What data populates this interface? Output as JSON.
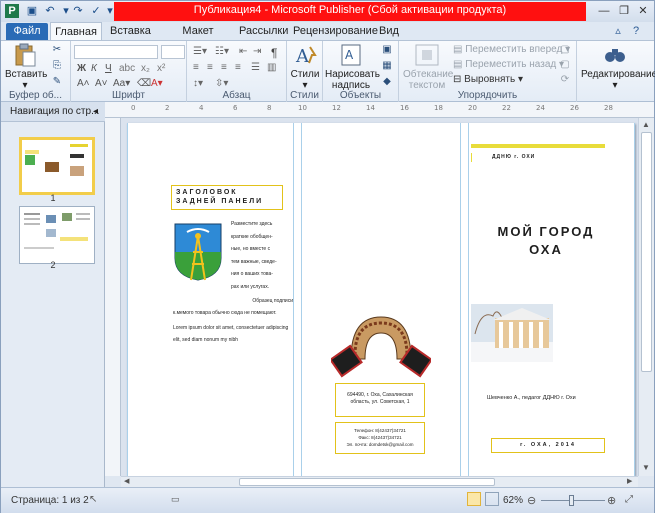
{
  "window": {
    "title": "Публикация4 - Microsoft Publisher (Сбой активации продукта)",
    "accent": "#ff1010"
  },
  "tabs": {
    "file": "Файл",
    "items": [
      "Главная",
      "Вставка",
      "Макет страницы",
      "Рассылки",
      "Рецензирование",
      "Вид"
    ]
  },
  "ribbon": {
    "clipboard": {
      "paste": "Вставить",
      "label": "Буфер об..."
    },
    "font": {
      "label": "Шрифт"
    },
    "paragraph": {
      "label": "Абзац"
    },
    "styles": {
      "button": "Стили",
      "label": "Стили"
    },
    "objects": {
      "draw_line1": "Нарисовать",
      "draw_line2": "надпись",
      "label": "Объекты"
    },
    "arrange": {
      "wrap_line1": "Обтекание",
      "wrap_line2": "текстом",
      "forward": "Переместить вперед",
      "backward": "Переместить назад",
      "align": "Выровнять",
      "label": "Упорядочить"
    },
    "editing": {
      "button": "Редактирование"
    }
  },
  "nav": {
    "title": "Навигация по стр...",
    "pages": [
      "1",
      "2"
    ]
  },
  "publication": {
    "back_panel_title": "ЗАГОЛОВОК ЗАДНЕЙ ПАНЕЛИ",
    "back_panel_text": [
      "Разместите здесь",
      "краткие обобщен-",
      "ные, но вместе с",
      "тем важные, сведе-",
      "ния о ваших това-",
      "рах или услугах.",
      "Образец подписи",
      "к.мемого товара обычно сюда не помещают."
    ],
    "lorem": "Lorem ipsum dolor sit amet, consectetuer adipiscing elit, sed diam nonum my nibh",
    "address": "694490, г. Оха, Сахалинская область, ул. Советская, 1",
    "contacts": [
      "Телефон: 8(42437)34721",
      "Факс: 8(42437)34721",
      "Эл. почта: domdetsk@gmail.com"
    ],
    "org": "ДДНЮ г. ОХИ",
    "main_title_line1": "МОЙ ГОРОД",
    "main_title_line2": "ОХА",
    "author": "Шевченко А., педагог ДДНЮ г. Охи",
    "footer": "г. ОХА, 2014"
  },
  "status": {
    "page": "Страница: 1 из 2",
    "zoom": "62%"
  }
}
